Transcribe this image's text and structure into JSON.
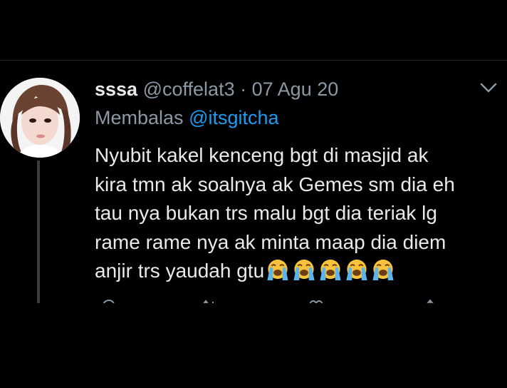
{
  "tweet": {
    "display_name": "sssa",
    "handle": "@coffelat3",
    "separator": "·",
    "date": "07 Agu 20",
    "reply_prefix": "Membalas",
    "reply_to": "@itsgitcha",
    "body_lines": [
      "Nyubit kakel kenceng bgt di masjid ak",
      "kira tmn ak soalnya ak Gemes sm dia eh",
      "tau nya bukan trs malu bgt dia teriak lg",
      "rame rame nya ak minta maap dia diem",
      "anjir trs yaudah gtu"
    ],
    "emoji_count": 5,
    "emoji_name": "loudly-crying-face"
  },
  "colors": {
    "background": "#000000",
    "text": "#e7e9ea",
    "muted": "#8b98a5",
    "accent": "#1d9bf0",
    "emoji_yellow": "#f7c23c",
    "emoji_tears": "#5ab4ee"
  },
  "icons": [
    "avatar-photo",
    "chevron-down-icon",
    "reply-icon",
    "retweet-icon",
    "like-icon",
    "share-icon"
  ]
}
